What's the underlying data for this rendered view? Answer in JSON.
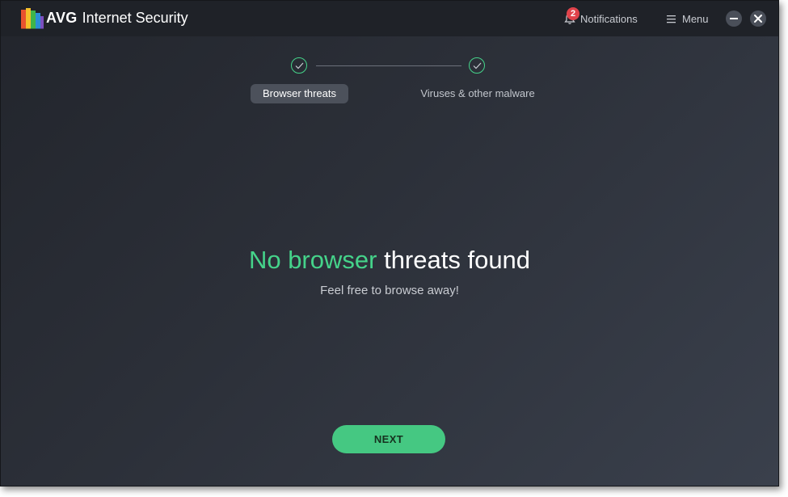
{
  "app": {
    "brand": "AVG",
    "product": "Internet Security"
  },
  "titlebar": {
    "notifications_label": "Notifications",
    "notifications_count": "2",
    "menu_label": "Menu",
    "minimize_icon": "minimize-icon",
    "close_icon": "close-icon"
  },
  "steps": [
    {
      "label": "Browser threats",
      "status": "done",
      "active": true
    },
    {
      "label": "Viruses & other malware",
      "status": "done",
      "active": false
    }
  ],
  "main": {
    "headline_accent": "No browser",
    "headline_rest": "threats found",
    "subline": "Feel free to browse away!",
    "next_label": "NEXT"
  },
  "colors": {
    "accent": "#45d38a",
    "button": "#45c882",
    "badge": "#e0434b",
    "titlebar": "#1f2228"
  }
}
